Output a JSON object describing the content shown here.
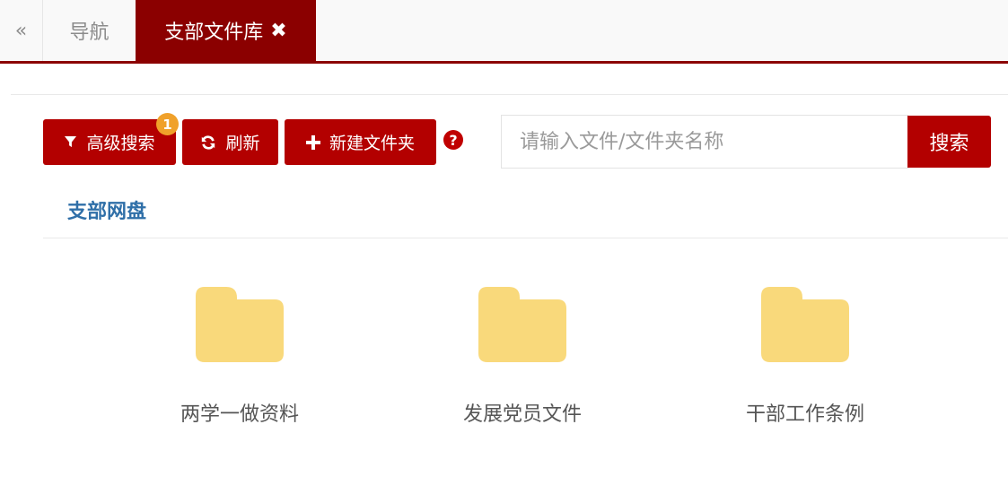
{
  "tabs": {
    "collapse_glyph": "«",
    "nav_label": "导航",
    "active_label": "支部文件库",
    "close_glyph": "✖",
    "accent_color": "#8b0000"
  },
  "toolbar": {
    "advanced_search_label": "高级搜索",
    "advanced_search_icon": "filter-icon",
    "advanced_search_badge": "1",
    "refresh_label": "刷新",
    "refresh_icon": "refresh-icon",
    "new_folder_label": "新建文件夹",
    "new_folder_icon": "plus-icon",
    "help_glyph": "?",
    "button_color": "#b30000"
  },
  "search": {
    "placeholder": "请输入文件/文件夹名称",
    "value": "",
    "button_label": "搜索"
  },
  "breadcrumb": {
    "root": "支部网盘"
  },
  "folders": [
    {
      "name": "两学一做资料",
      "icon": "folder-icon"
    },
    {
      "name": "发展党员文件",
      "icon": "folder-icon"
    },
    {
      "name": "干部工作条例",
      "icon": "folder-icon"
    }
  ],
  "colors": {
    "folder": "#f9d97b",
    "link": "#2f6fa8",
    "badge": "#f0a12a"
  }
}
